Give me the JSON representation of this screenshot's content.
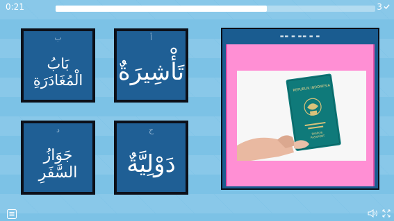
{
  "header": {
    "timer": "0:21",
    "progress": 0.66,
    "score": "3"
  },
  "cards": [
    {
      "letter": "أ",
      "word": "تَأْشِيرَةٌ",
      "size": 34
    },
    {
      "letter": "ب",
      "word": "بَابُ الْمُغَادَرَةِ",
      "size": 21
    },
    {
      "letter": "ج",
      "word": "دَوْلِيَّةٌ",
      "size": 34
    },
    {
      "letter": "د",
      "word": "جَوَازُ السَّفَرِ",
      "size": 22
    }
  ],
  "image_panel": {
    "header_text": "▬▬ ▬ ▬▬ ▬ ▬",
    "passport_title": "REPUBLIK INDONESIA",
    "passport_sub": "PASPOR",
    "passport_sub2": "PASSPORT"
  },
  "footer": {
    "menu_icon": "menu-icon",
    "audio_icon": "speaker-icon",
    "fullscreen_icon": "fullscreen-icon"
  },
  "colors": {
    "card_bg": "#1f5f95",
    "card_border": "#0c0f18",
    "pink": "#ff8fd4",
    "passport": "#0f7a7a"
  }
}
